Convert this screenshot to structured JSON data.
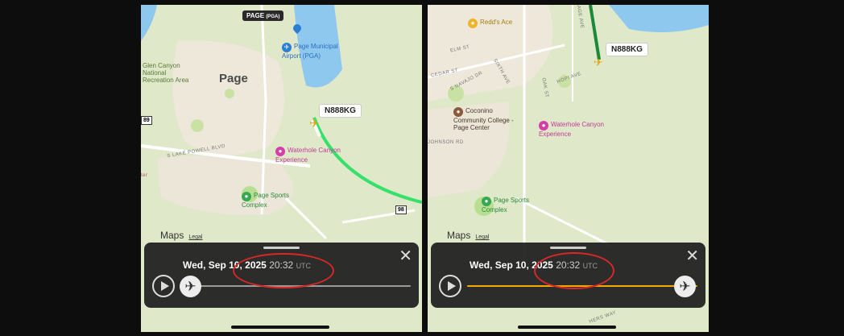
{
  "left": {
    "top_label": "PAGE",
    "top_label_code": "(PGA)",
    "airport_name": "Page Municipal Airport (PGA)",
    "area_name": "Glen Canyon National Recreation Area",
    "town": "Page",
    "aircraft_tag": "N888KG",
    "route_badge_a": "89",
    "route_badge_b": "98",
    "street_1": "S LAKE POWELL BLVD",
    "poi_waterhole": "Waterhole Canyon Experience",
    "poi_sports": "Page Sports Complex",
    "maps_logo": "Maps",
    "legal": "Legal",
    "edge_text": "ter",
    "timeline": {
      "date": "Wed, Sep 10, 2025",
      "time": "20:32",
      "tz": "UTC",
      "progress": 0.0
    }
  },
  "right": {
    "aircraft_tag": "N888KG",
    "poi_reddsace": "Redd's Ace",
    "poi_college": "Coconino Community College - Page Center",
    "poi_waterhole": "Waterhole Canyon Experience",
    "poi_sports": "Page Sports Complex",
    "street_elm": "ELM ST",
    "street_cedar": "CEDAR ST",
    "street_navajo": "S NAVAJO DR",
    "street_hopi": "HOPI AVE",
    "street_sage": "SAGE AVE",
    "street_oak": "OAK ST",
    "street_sixth": "SIXTH AVE",
    "street_johnson": "JOHNSON RD",
    "street_stagecoach": "HERS WAY",
    "maps_logo": "Maps",
    "legal": "Legal",
    "timeline": {
      "date": "Wed, Sep 10, 2025",
      "time": "20:32",
      "tz": "UTC",
      "progress": 1.0
    }
  },
  "icons": {
    "close": "close-icon",
    "play": "play-icon",
    "plane": "airplane-icon",
    "apple": "apple-logo-icon"
  },
  "colors": {
    "track_done_left": "#d8d8d8",
    "track_done_right": "#f2a900",
    "flight_path_left": "#35e06b",
    "flight_path_right": "#1a8a3a",
    "annotation": "#d9262a",
    "aircraft": "#e0a817"
  }
}
